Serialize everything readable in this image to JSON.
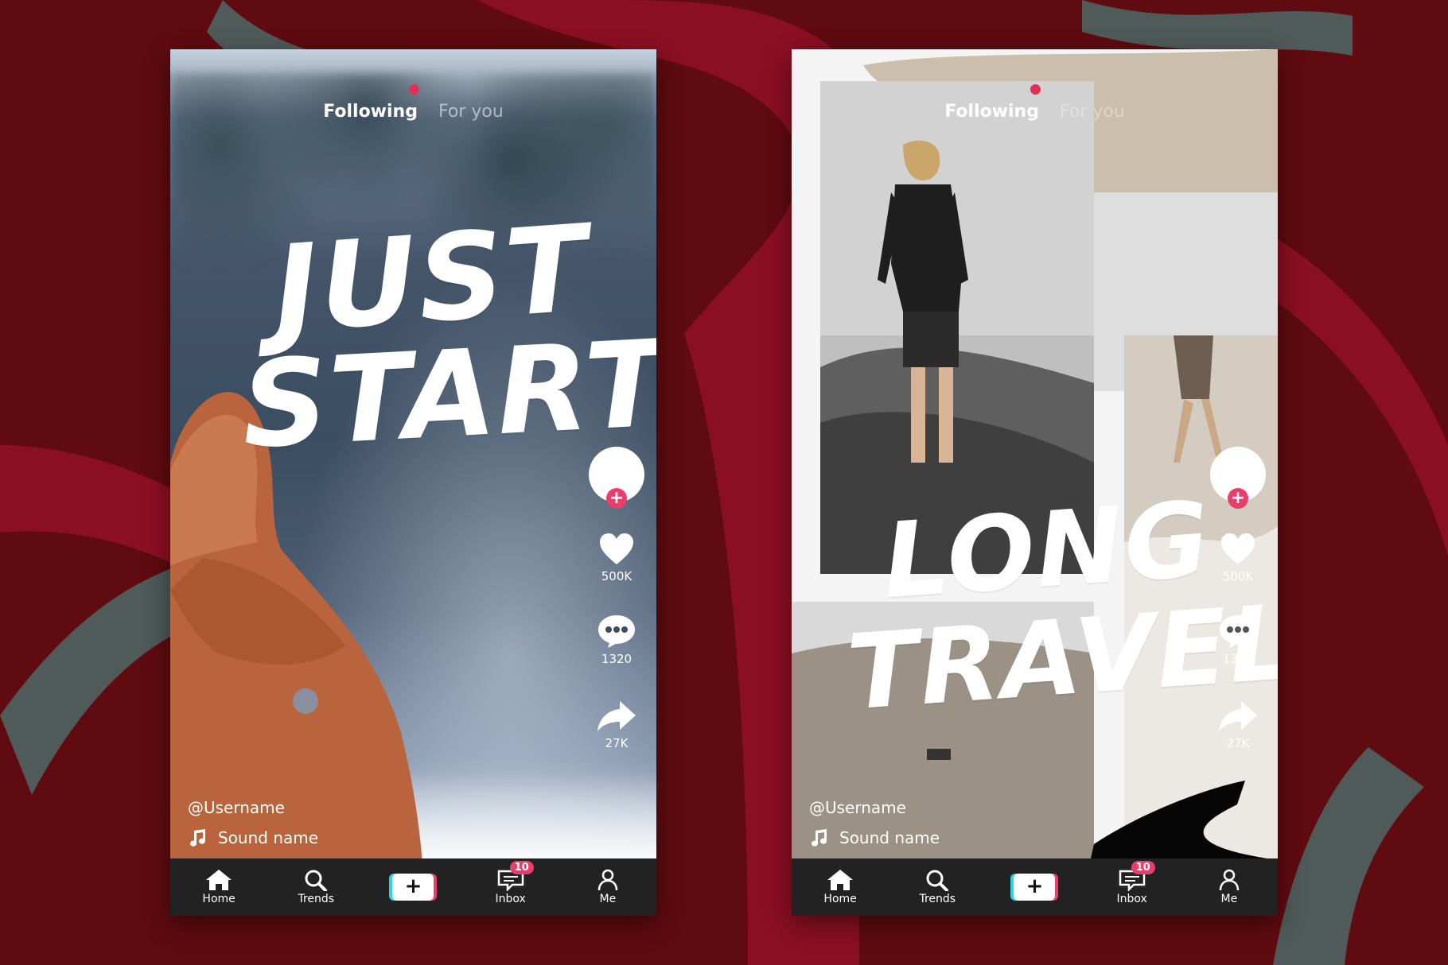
{
  "phones": [
    {
      "tabs": {
        "following": "Following",
        "for_you": "For you"
      },
      "headline": {
        "line1": "Just",
        "line2": "Start"
      },
      "stats": {
        "likes": "500K",
        "comments": "1320",
        "shares": "27K"
      },
      "username": "@Username",
      "sound": "Sound name",
      "nav": {
        "home": "Home",
        "trends": "Trends",
        "inbox": "Inbox",
        "inbox_badge": "10",
        "me": "Me",
        "create": "+"
      }
    },
    {
      "tabs": {
        "following": "Following",
        "for_you": "For you"
      },
      "headline": {
        "line1": "Long",
        "line2": "Travel"
      },
      "stats": {
        "likes": "500K",
        "comments": "1320",
        "shares": "27K"
      },
      "username": "@Username",
      "sound": "Sound name",
      "nav": {
        "home": "Home",
        "trends": "Trends",
        "inbox": "Inbox",
        "inbox_badge": "10",
        "me": "Me",
        "create": "+"
      }
    }
  ],
  "colors": {
    "background": "#5f0b10",
    "ribbon_red": "#8b0f22",
    "ribbon_grey": "#4f5a59",
    "accent_pink": "#ec3c6a",
    "accent_cyan": "#2ed3e0",
    "nav_bg": "#222222"
  }
}
